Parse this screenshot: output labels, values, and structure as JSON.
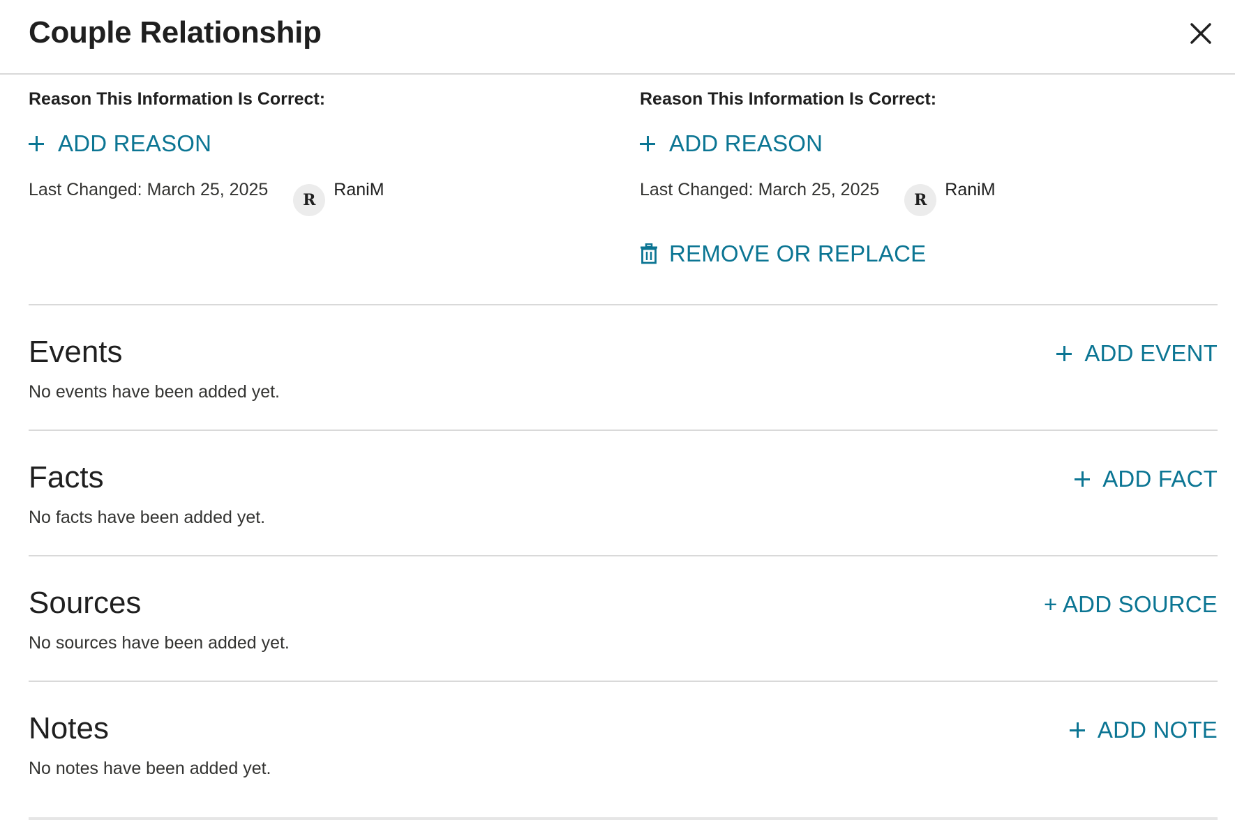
{
  "header": {
    "title": "Couple Relationship",
    "close_icon": "close-icon"
  },
  "columns": [
    {
      "reason_label": "Reason This Information Is Correct:",
      "add_reason": "ADD REASON",
      "last_changed": "Last Changed: March 25, 2025",
      "avatar_initial": "R",
      "username": "RaniM"
    },
    {
      "reason_label": "Reason This Information Is Correct:",
      "add_reason": "ADD REASON",
      "last_changed": "Last Changed: March 25, 2025",
      "avatar_initial": "R",
      "username": "RaniM",
      "remove_replace": "REMOVE OR REPLACE"
    }
  ],
  "sections": {
    "events": {
      "title": "Events",
      "empty": "No events have been added yet.",
      "action": "ADD EVENT"
    },
    "facts": {
      "title": "Facts",
      "empty": "No facts have been added yet.",
      "action": "ADD FACT"
    },
    "sources": {
      "title": "Sources",
      "empty": "No sources have been added yet.",
      "action": "+ ADD SOURCE"
    },
    "notes": {
      "title": "Notes",
      "empty": "No notes have been added yet.",
      "action": "ADD NOTE"
    }
  },
  "colors": {
    "link": "#0b7593",
    "divider": "#d9d9d9",
    "text": "#333331"
  }
}
